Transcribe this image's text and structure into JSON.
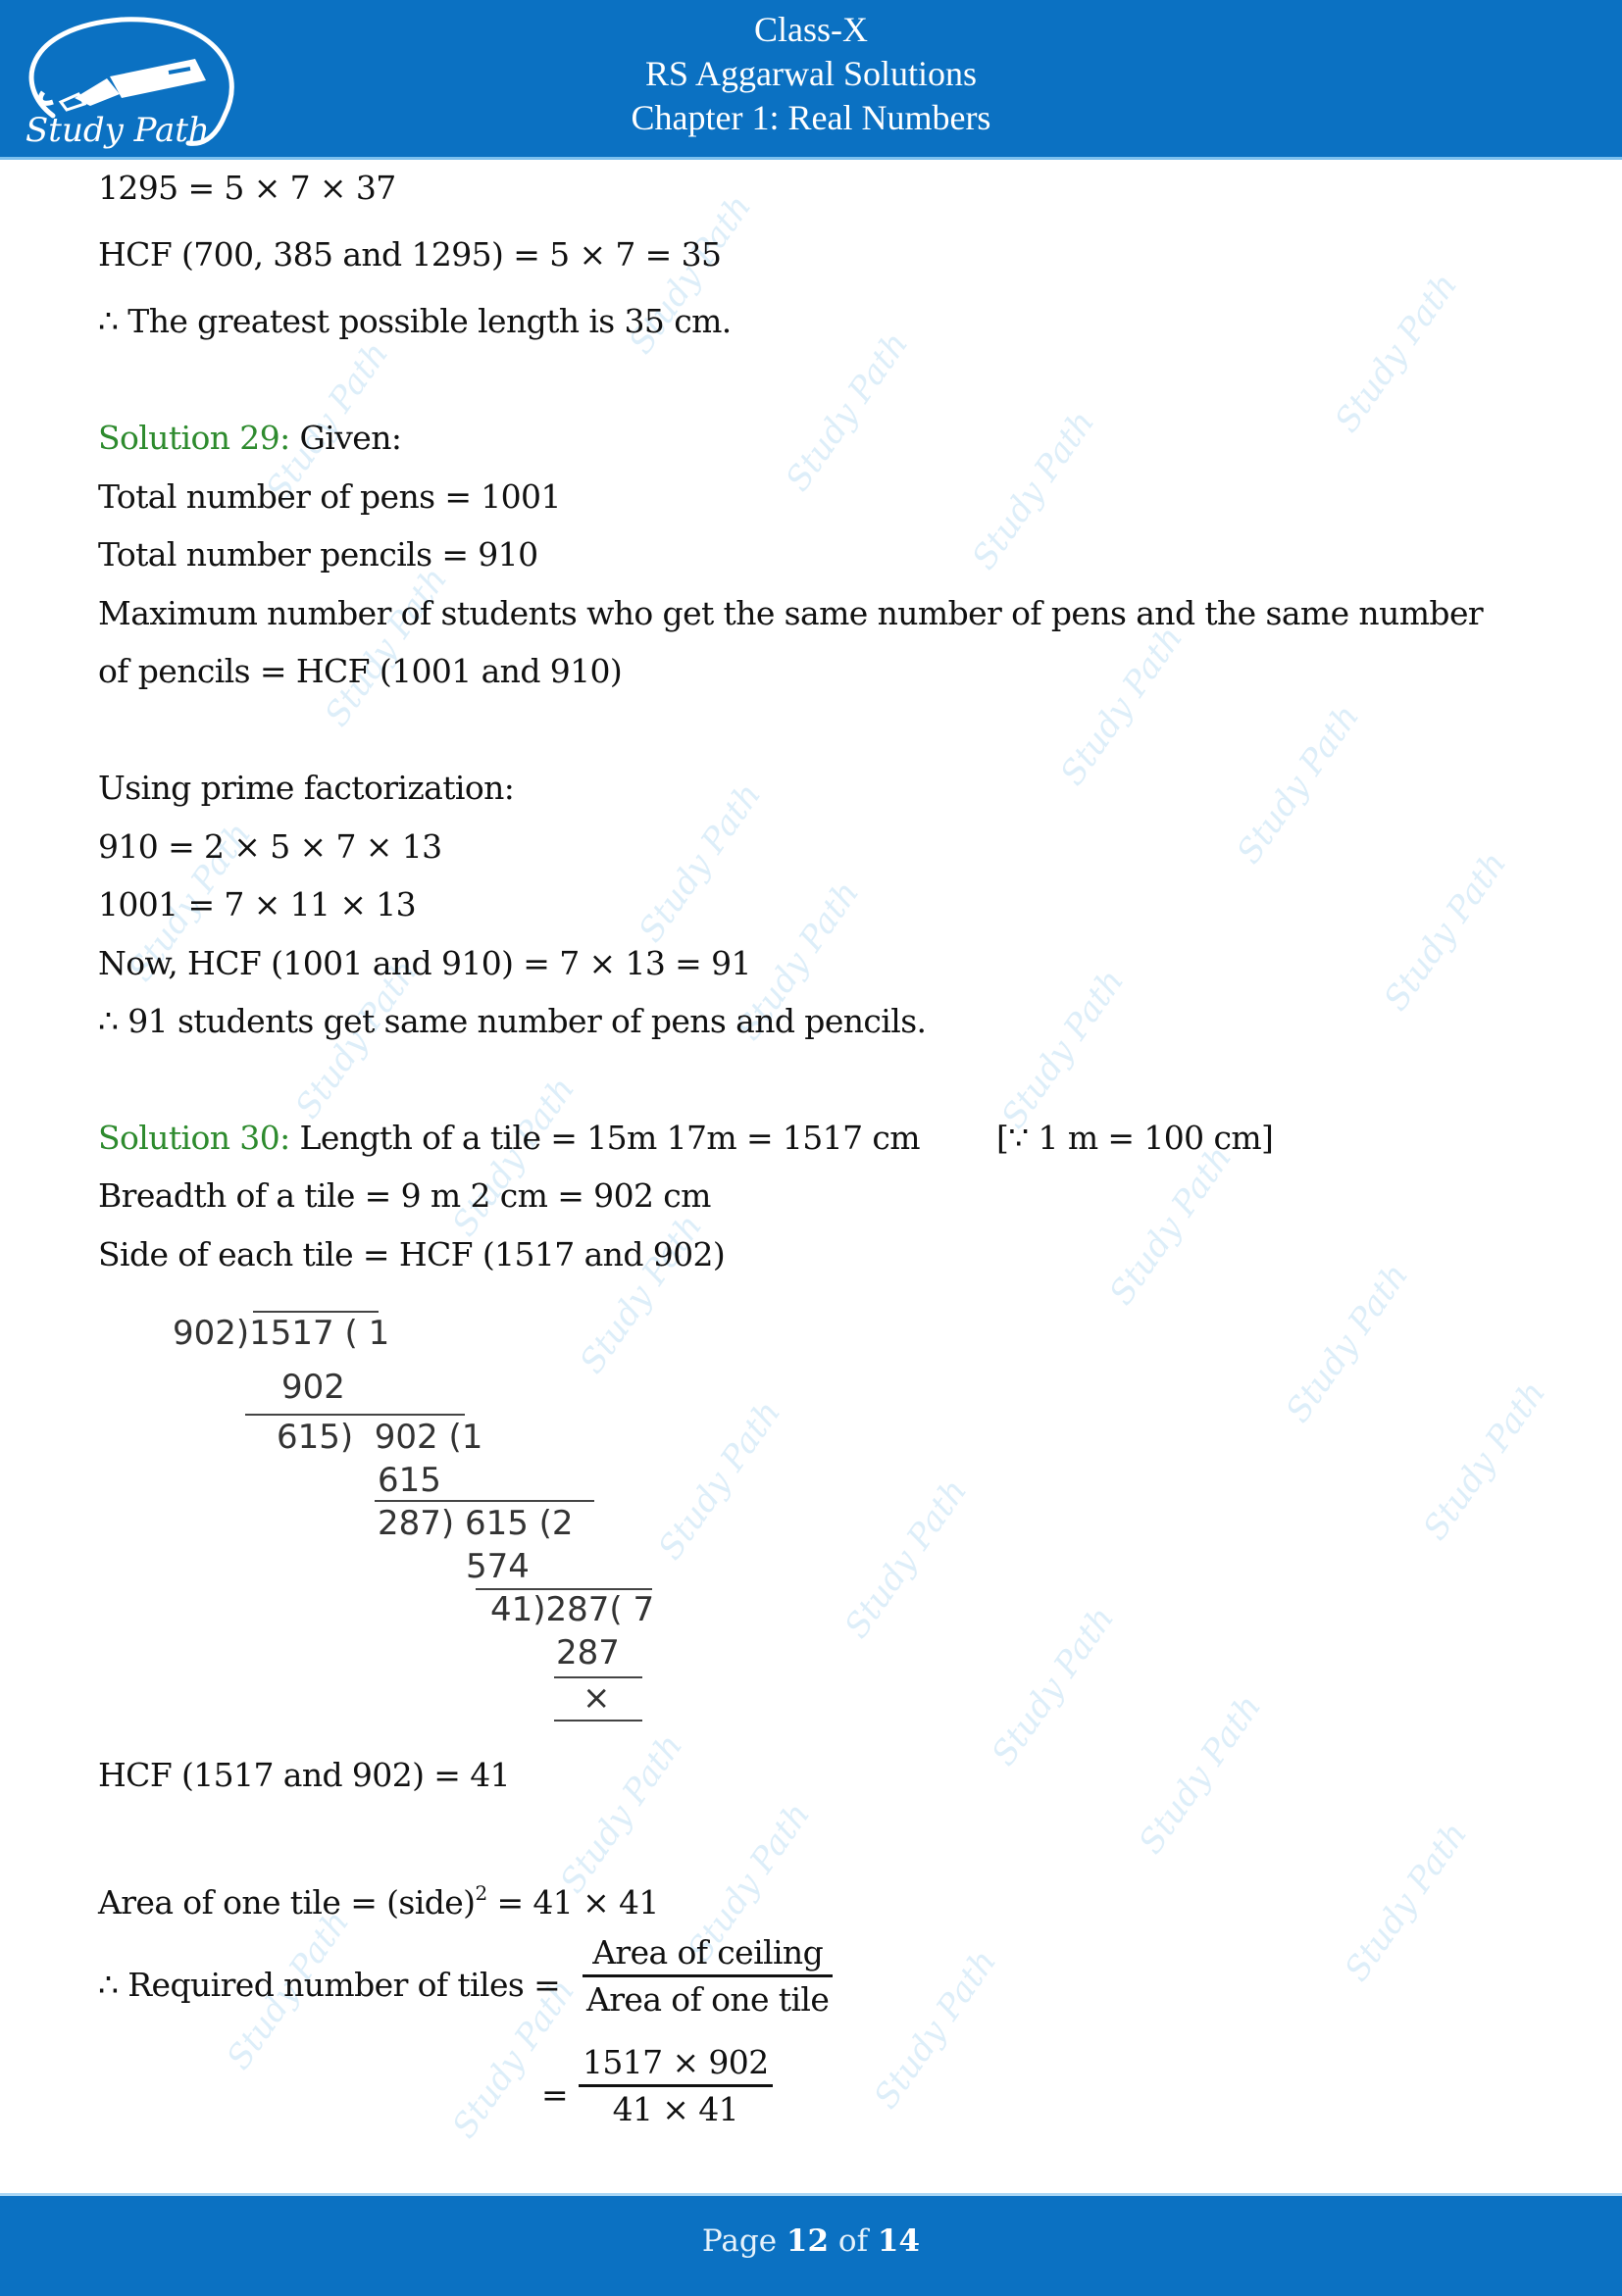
{
  "header": {
    "logo_text": "Study Path",
    "class_title": "Class-X",
    "book_title": "RS Aggarwal Solutions",
    "chapter_title": "Chapter 1: Real Numbers"
  },
  "watermark_text": "Study Path",
  "sol28_tail": {
    "line1": "1295 = 5 × 7 × 37",
    "line2": "HCF (700, 385 and 1295) = 5 × 7 = 35",
    "line3": "∴ The greatest possible length is 35 cm."
  },
  "sol29": {
    "label": "Solution 29:",
    "intro": " Given:",
    "lines": [
      "Total number of pens = 1001",
      "Total number pencils = 910",
      "Maximum number of students who get the same number of pens and the same number",
      "of pencils = HCF (1001 and 910)",
      "Using prime factorization:",
      "910 = 2 × 5 × 7 × 13",
      "1001 = 7 × 11 × 13",
      "Now, HCF (1001 and 910) = 7 × 13 = 91",
      "∴ 91 students get same number of pens and pencils."
    ]
  },
  "sol30": {
    "label": "Solution 30:",
    "intro": " Length of a tile = 15m 17m = 1517 cm",
    "note": "[∵ 1 m = 100 cm]",
    "lines": [
      "Breadth of a tile = 9 m 2 cm = 902 cm",
      "Side of each tile = HCF (1517 and 902)"
    ],
    "division": {
      "r1": "902)1517 ( 1",
      "r2": "902",
      "r3": "615)  902 (1",
      "r4": "615",
      "r5": "287) 615 (2",
      "r6": "574",
      "r7": "41)287( 7",
      "r8": "287",
      "r9": "×"
    },
    "hcf_result": "HCF (1517 and 902) = 41",
    "area_prefix": "Area of one tile = (side)",
    "area_sup": "2",
    "area_suffix": " = 41 × 41",
    "required_label": "∴ Required number of tiles =",
    "frac1_num": "Area of ceiling",
    "frac1_den": "Area of one tile",
    "eq_sign": "=",
    "frac2_num": "1517 × 902",
    "frac2_den": "41 × 41"
  },
  "footer": {
    "page_word": "Page",
    "current_page": "12",
    "of_word": "of",
    "total_pages": "14"
  },
  "colors": {
    "header_blue": "#0b71c2",
    "solution_green": "#2e8b2e"
  }
}
